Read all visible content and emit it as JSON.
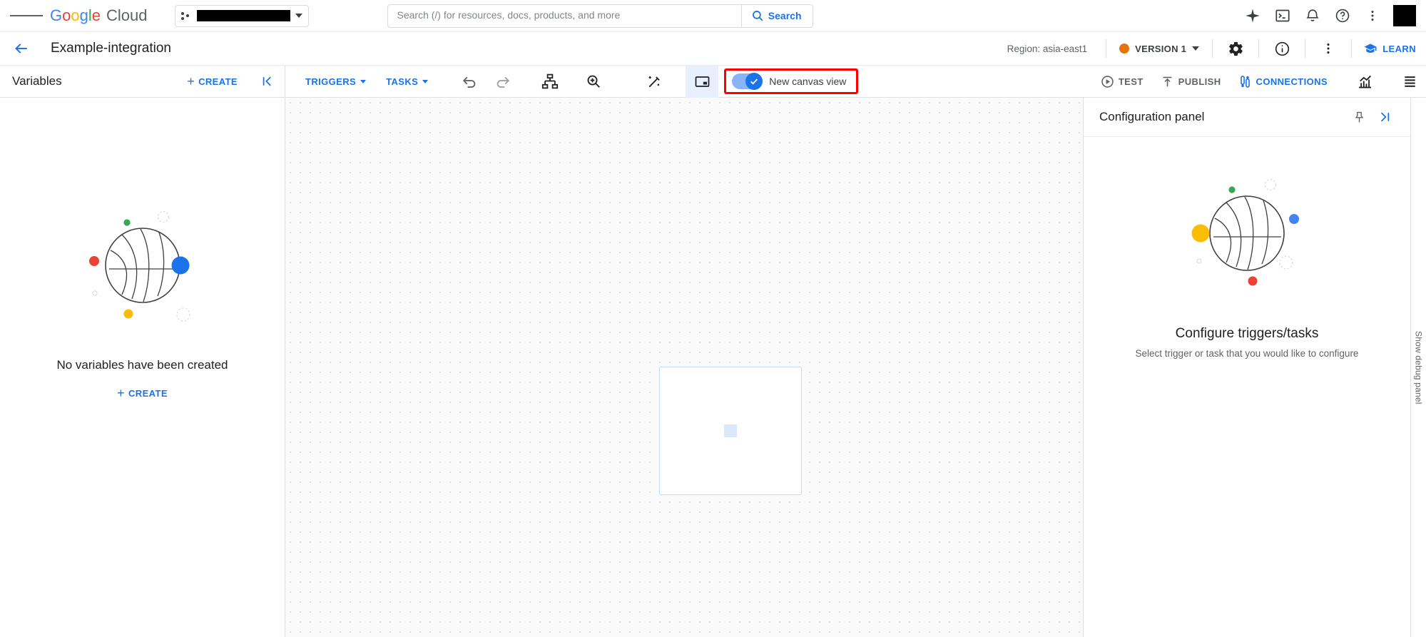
{
  "topbar": {
    "menu_icon": "hamburger-menu-icon",
    "brand": {
      "google": "Google",
      "cloud": "Cloud"
    },
    "project_selector": {
      "icon": "project-dots-icon",
      "value": "",
      "redacted": true,
      "caret": "chevron-down-icon"
    },
    "search": {
      "placeholder": "Search (/) for resources, docs, products, and more",
      "value": "",
      "button_label": "Search",
      "button_icon": "search-icon"
    },
    "icons": [
      {
        "name": "gemini-sparkle-icon",
        "label": "Gemini"
      },
      {
        "name": "cloud-shell-terminal-icon",
        "label": "Activate Cloud Shell"
      },
      {
        "name": "notifications-bell-icon",
        "label": "Notifications"
      },
      {
        "name": "help-question-icon",
        "label": "Support"
      },
      {
        "name": "more-vert-icon",
        "label": "More options"
      }
    ],
    "avatar": {
      "name": "user-avatar",
      "redacted": true
    }
  },
  "subheader": {
    "back_icon": "arrow-back-icon",
    "title": "Example-integration",
    "region_text": "Region: asia-east1",
    "version": {
      "status_color": "#e8710a",
      "label": "VERSION 1",
      "caret": "chevron-down-icon"
    },
    "icons": [
      {
        "name": "settings-gear-icon",
        "label": "Settings"
      },
      {
        "name": "info-circle-icon",
        "label": "Info"
      },
      {
        "name": "more-vert-icon",
        "label": "More"
      }
    ],
    "learn": {
      "icon": "school-cap-icon",
      "label": "LEARN"
    }
  },
  "toolbar": {
    "variables_title": "Variables",
    "create_label": "CREATE",
    "collapse_icon": "collapse-left-icon",
    "triggers_label": "TRIGGERS",
    "tasks_label": "TASKS",
    "undo_icon": "undo-icon",
    "redo_icon": "redo-icon",
    "layout_icon": "org-chart-layout-icon",
    "zoom_icon": "zoom-in-icon",
    "magic_icon": "magic-wand-icon",
    "minimap_icon": "minimap-toggle-icon",
    "new_canvas_view": {
      "label": "New canvas view",
      "enabled": true,
      "highlight_color": "#ff0000"
    },
    "test_label": "TEST",
    "publish_label": "PUBLISH",
    "connections_label": "CONNECTIONS",
    "analytics_icon": "analytics-chart-icon",
    "logs_icon": "logs-list-icon"
  },
  "left_panel": {
    "empty_text": "No variables have been created",
    "create_label": "CREATE"
  },
  "canvas": {
    "card_placeholder": "task-card-placeholder"
  },
  "right_panel": {
    "title": "Configuration panel",
    "pin_icon": "pin-icon",
    "collapse_icon": "collapse-right-icon",
    "empty_title": "Configure triggers/tasks",
    "empty_subtitle": "Select trigger or task that you would like to configure"
  },
  "debug_rail": {
    "label": "Show debug panel"
  },
  "colors": {
    "accent_blue": "#1a73e8",
    "light_blue": "#8ab4f8",
    "orange": "#e8710a",
    "red_highlight": "#ff0000",
    "text_primary": "#202124",
    "text_secondary": "#5f6368",
    "illus_blue": "#1a73e8",
    "illus_red": "#ea4335",
    "illus_yellow": "#fbbc04",
    "illus_green": "#34a853"
  }
}
